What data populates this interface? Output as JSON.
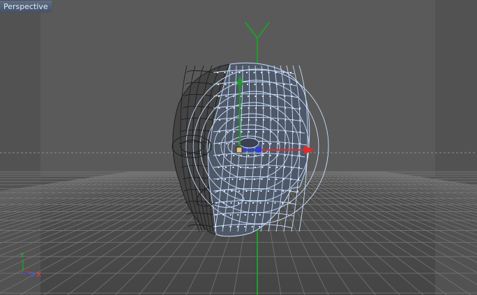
{
  "viewport": {
    "label": "Perspective",
    "colors": {
      "background": "#4a4a4a",
      "floor_grid": "#7a7a7a",
      "mesh_unselected": "#1e1e1e",
      "mesh_selected": "#c8ddff",
      "axis_x": "#e02a2a",
      "axis_y": "#1f9d2a",
      "axis_z": "#2a3ee0"
    }
  },
  "world_axis": {
    "y_label": "Y"
  },
  "gizmo": {
    "x_label": "X",
    "y_label": "Y",
    "z_label": "Z"
  },
  "icons": [
    "world-y-axis-icon",
    "move-gizmo-icon",
    "orientation-gizmo-icon"
  ]
}
